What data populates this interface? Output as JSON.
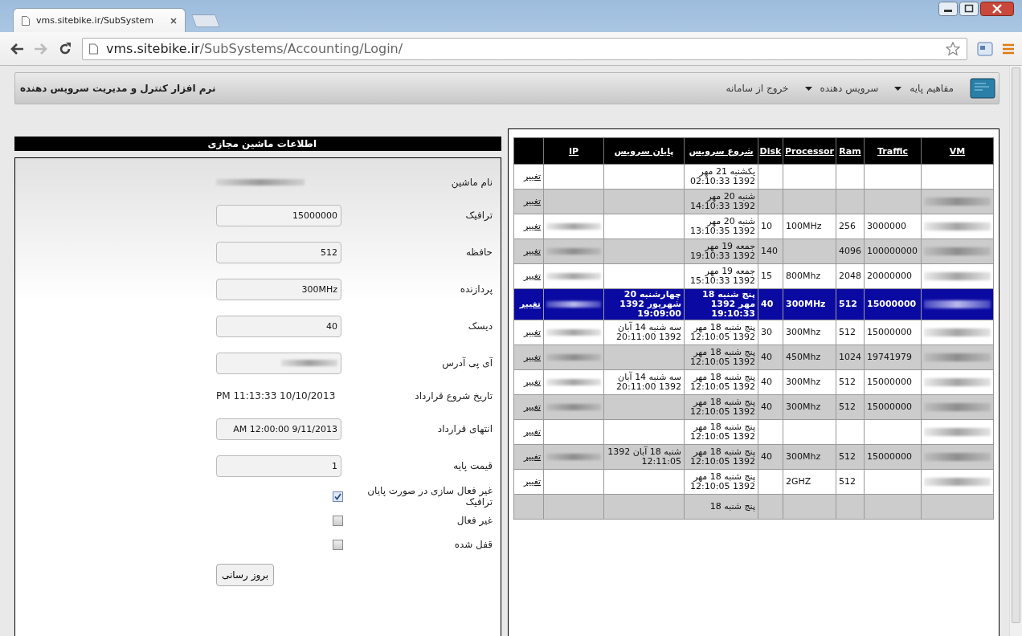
{
  "browser": {
    "tab_title": "vms.sitebike.ir/SubSystem",
    "url_host": "vms.sitebike.ir",
    "url_path": "/SubSystems/Accounting/Login/"
  },
  "header": {
    "menu": [
      {
        "label": "مفاهیم پایه",
        "dropdown": true
      },
      {
        "label": "سرویس دهنده",
        "dropdown": true
      },
      {
        "label": "خروج از سامانه",
        "dropdown": false
      }
    ],
    "title": "نرم افزار کنترل و مدیریت سرویس دهنده"
  },
  "table": {
    "columns": [
      "VM",
      "Traffic",
      "Ram",
      "Processor",
      "Disk",
      "شروع سرویس",
      "پایان سرویس",
      "IP"
    ],
    "rows": [
      {
        "vm_redacted": false,
        "traffic": "",
        "ram": "",
        "processor": "",
        "disk": "",
        "start": "یکشنبه 21 مهر 1392 02:10:33",
        "end": "",
        "ip_redacted": false,
        "action": "تغییر",
        "selected": false
      },
      {
        "vm_redacted": true,
        "traffic": "",
        "ram": "",
        "processor": "",
        "disk": "",
        "start": "شنبه 20 مهر 1392 14:10:33",
        "end": "",
        "ip_redacted": false,
        "action": "تغییر",
        "selected": false
      },
      {
        "vm_redacted": true,
        "traffic": "3000000",
        "ram": "256",
        "processor": "100MHz",
        "disk": "10",
        "start": "شنبه 20 مهر 1392 13:10:35",
        "end": "",
        "ip_redacted": true,
        "action": "تغییر",
        "selected": false
      },
      {
        "vm_redacted": true,
        "traffic": "100000000",
        "ram": "4096",
        "processor": "",
        "disk": "140",
        "start": "جمعه 19 مهر 1392 19:10:33",
        "end": "",
        "ip_redacted": true,
        "action": "تغییر",
        "selected": false
      },
      {
        "vm_redacted": true,
        "traffic": "20000000",
        "ram": "2048",
        "processor": "800Mhz",
        "disk": "15",
        "start": "جمعه 19 مهر 1392 15:10:33",
        "end": "",
        "ip_redacted": true,
        "action": "تغییر",
        "selected": false
      },
      {
        "vm_redacted": true,
        "traffic": "15000000",
        "ram": "512",
        "processor": "300MHz",
        "disk": "40",
        "start": "پنج شنبه 18 مهر 1392 19:10:33",
        "end": "چهارشنبه 20 شهریور 1392 19:09:00",
        "ip_redacted": true,
        "action": "تغییر",
        "selected": true
      },
      {
        "vm_redacted": true,
        "traffic": "15000000",
        "ram": "512",
        "processor": "300Mhz",
        "disk": "30",
        "start": "پنج شنبه 18 مهر 1392 12:10:05",
        "end": "سه شنبه 14 آبان 1392 20:11:00",
        "ip_redacted": true,
        "action": "تغییر",
        "selected": false
      },
      {
        "vm_redacted": true,
        "traffic": "19741979",
        "ram": "1024",
        "processor": "450Mhz",
        "disk": "40",
        "start": "پنج شنبه 18 مهر 1392 12:10:05",
        "end": "",
        "ip_redacted": true,
        "action": "تغییر",
        "selected": false
      },
      {
        "vm_redacted": true,
        "traffic": "15000000",
        "ram": "512",
        "processor": "300Mhz",
        "disk": "40",
        "start": "پنج شنبه 18 مهر 1392 12:10:05",
        "end": "سه شنبه 14 آبان 1392 20:11:00",
        "ip_redacted": true,
        "action": "تغییر",
        "selected": false
      },
      {
        "vm_redacted": true,
        "traffic": "15000000",
        "ram": "512",
        "processor": "300Mhz",
        "disk": "40",
        "start": "پنج شنبه 18 مهر 1392 12:10:05",
        "end": "",
        "ip_redacted": true,
        "action": "تغییر",
        "selected": false
      },
      {
        "vm_redacted": true,
        "traffic": "",
        "ram": "",
        "processor": "",
        "disk": "",
        "start": "پنج شنبه 18 مهر 1392 12:10:05",
        "end": "",
        "ip_redacted": false,
        "action": "تغییر",
        "selected": false
      },
      {
        "vm_redacted": true,
        "traffic": "15000000",
        "ram": "512",
        "processor": "300Mhz",
        "disk": "40",
        "start": "پنج شنبه 18 مهر 1392 12:10:05",
        "end": "شنبه 18 آبان 1392 12:11:05",
        "ip_redacted": true,
        "action": "تغییر",
        "selected": false
      },
      {
        "vm_redacted": true,
        "traffic": "",
        "ram": "512",
        "processor": "2GHZ",
        "disk": "",
        "start": "پنج شنبه 18 مهر 1392 12:10:05",
        "end": "",
        "ip_redacted": false,
        "action": "تغییر",
        "selected": false
      },
      {
        "vm_redacted": false,
        "traffic": "",
        "ram": "",
        "processor": "",
        "disk": "",
        "start": "پنج شنبه 18",
        "end": "",
        "ip_redacted": false,
        "selected": false
      }
    ]
  },
  "details": {
    "title": "اطلاعات ماشین مجازی",
    "fields": [
      {
        "kind": "text",
        "label": "نام ماشین",
        "redacted": true
      },
      {
        "kind": "input",
        "label": "ترافیک",
        "value": "15000000"
      },
      {
        "kind": "input",
        "label": "حافظه",
        "value": "512"
      },
      {
        "kind": "input",
        "label": "پردازنده",
        "value": "300MHz"
      },
      {
        "kind": "input",
        "label": "دیسک",
        "value": "40"
      },
      {
        "kind": "input",
        "label": "آی پی آدرس",
        "redacted": true
      },
      {
        "kind": "text",
        "label": "تاریخ شروع قرارداد",
        "value": "PM 11:13:33 10/10/2013"
      },
      {
        "kind": "input",
        "label": "انتهای قرارداد",
        "value": "AM 12:00:00 9/11/2013"
      },
      {
        "kind": "input",
        "label": "قیمت پایه",
        "value": "1"
      },
      {
        "kind": "checkbox",
        "label": "غیر فعال سازی در صورت پایان ترافیک",
        "checked": true
      },
      {
        "kind": "checkbox",
        "label": "غیر فعال",
        "checked": false
      },
      {
        "kind": "checkbox",
        "label": "قفل شده",
        "checked": false
      }
    ],
    "button": "بروز رسانی"
  }
}
